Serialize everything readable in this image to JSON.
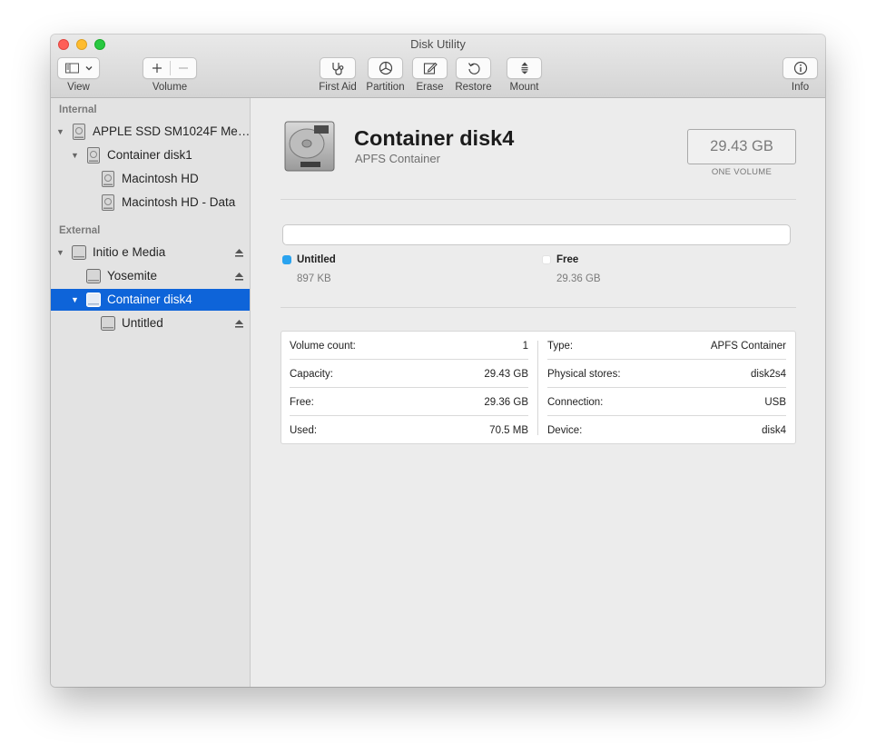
{
  "window": {
    "title": "Disk Utility"
  },
  "toolbar": {
    "view_label": "View",
    "volume_label": "Volume",
    "first_aid_label": "First Aid",
    "partition_label": "Partition",
    "erase_label": "Erase",
    "restore_label": "Restore",
    "mount_label": "Mount",
    "info_label": "Info"
  },
  "sidebar": {
    "internal_label": "Internal",
    "external_label": "External",
    "items": [
      {
        "label": "APPLE SSD SM1024F Me…",
        "level": 0,
        "disclosure": "open",
        "icon": "internal-disk-icon",
        "eject": false,
        "selected": false
      },
      {
        "label": "Container disk1",
        "level": 1,
        "disclosure": "open",
        "icon": "internal-disk-icon",
        "eject": false,
        "selected": false
      },
      {
        "label": "Macintosh HD",
        "level": 2,
        "disclosure": "none",
        "icon": "internal-disk-icon",
        "eject": false,
        "selected": false
      },
      {
        "label": "Macintosh HD - Data",
        "level": 2,
        "disclosure": "none",
        "icon": "internal-disk-icon",
        "eject": false,
        "selected": false
      },
      {
        "label": "Initio e Media",
        "level": 0,
        "disclosure": "open",
        "icon": "external-disk-icon",
        "eject": true,
        "selected": false
      },
      {
        "label": "Yosemite",
        "level": 1,
        "disclosure": "none",
        "icon": "external-disk-icon",
        "eject": true,
        "selected": false
      },
      {
        "label": "Container disk4",
        "level": 1,
        "disclosure": "open",
        "icon": "external-disk-icon",
        "eject": false,
        "selected": true
      },
      {
        "label": "Untitled",
        "level": 2,
        "disclosure": "none",
        "icon": "external-disk-icon",
        "eject": true,
        "selected": false
      }
    ]
  },
  "detail": {
    "name": "Container disk4",
    "subtitle": "APFS Container",
    "size": "29.43 GB",
    "size_caption": "ONE VOLUME",
    "usage": [
      {
        "name": "Untitled",
        "value": "897 KB",
        "color": "#2aa3ef"
      },
      {
        "name": "Free",
        "value": "29.36 GB",
        "color": "#ffffff"
      }
    ],
    "info_left": [
      {
        "key": "Volume count:",
        "value": "1"
      },
      {
        "key": "Capacity:",
        "value": "29.43 GB"
      },
      {
        "key": "Free:",
        "value": "29.36 GB"
      },
      {
        "key": "Used:",
        "value": "70.5 MB"
      }
    ],
    "info_right": [
      {
        "key": "Type:",
        "value": "APFS Container"
      },
      {
        "key": "Physical stores:",
        "value": "disk2s4"
      },
      {
        "key": "Connection:",
        "value": "USB"
      },
      {
        "key": "Device:",
        "value": "disk4"
      }
    ]
  },
  "colors": {
    "selection": "#0e64d9",
    "accent": "#2aa3ef"
  }
}
